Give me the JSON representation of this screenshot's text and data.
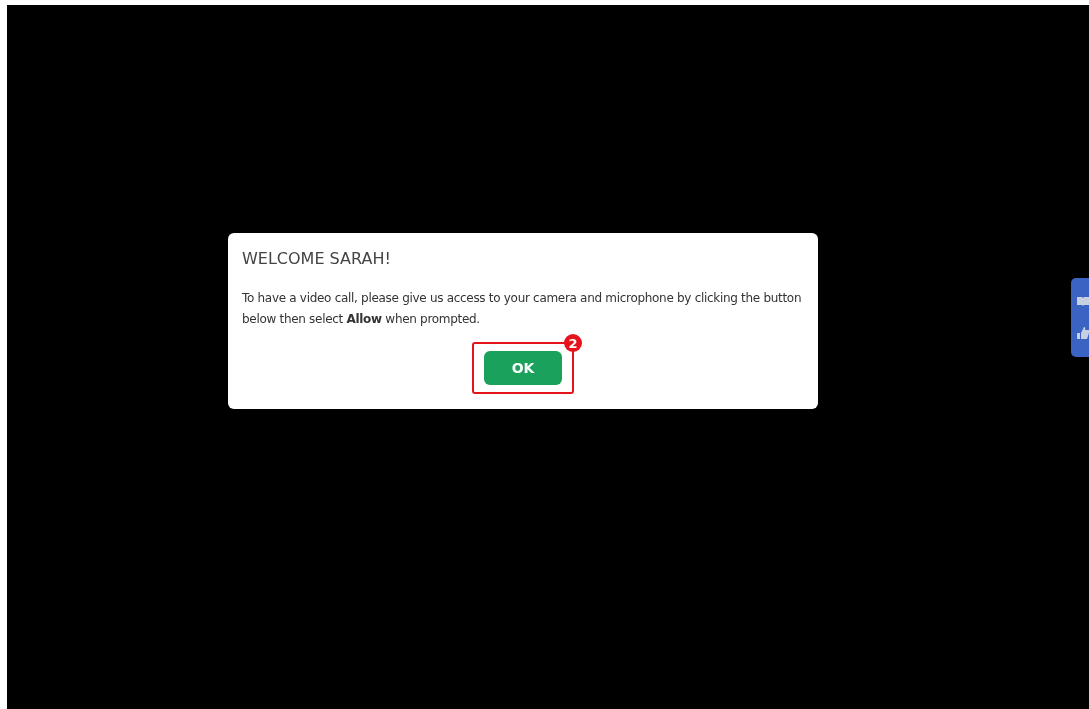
{
  "dialog": {
    "title": "WELCOME SARAH!",
    "message": "To have a video call, please give us access to your camera and microphone by clicking the button below then select **Allow** when prompted.",
    "button": {
      "label": "OK",
      "highlighted": true,
      "step": "2"
    }
  },
  "side_tab": {
    "kind": "feedback"
  }
}
